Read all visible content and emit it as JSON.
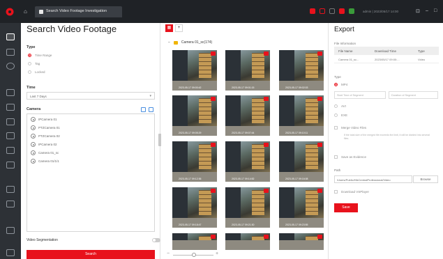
{
  "colors": {
    "accent": "#e8121c",
    "topbar": "#1f2226",
    "nav": "#2d3136"
  },
  "topbar": {
    "tab_label": "Search Video Footage Investigation",
    "user_text": "admin  |  2023/05/17 14:00",
    "icons": [
      "alarm-icon",
      "flag-icon",
      "bell-icon",
      "message-icon",
      "screen-icon"
    ]
  },
  "nav": {
    "icons": [
      "search-icon",
      "monitor-icon",
      "map-icon",
      "event-icon",
      "log-icon",
      "person-icon",
      "vehicle-icon",
      "storage-icon",
      "device-icon",
      "report-icon",
      "file-icon",
      "settings-icon",
      "tool-icon"
    ]
  },
  "search": {
    "title": "Search Video Footage",
    "type_label": "Type",
    "types": [
      "Time Range",
      "Tag",
      "Locked"
    ],
    "time_label": "Time",
    "time_value": "Last 7 Days",
    "camera_label": "Camera",
    "cameras": [
      "IPCamera 01",
      "PTZCamera 01",
      "PTZCamera 02",
      "IPCamera 02",
      "Camera 01_sc",
      "Camera 01/1/1"
    ],
    "segmentation_label": "Video Segmentation",
    "search_button": "Search"
  },
  "grid": {
    "camera_heading": "Camera 01_sc(174)",
    "thumbs": [
      {
        "ts": "2023-05-17 09:00:42"
      },
      {
        "ts": "2023-05-17 09:01:15"
      },
      {
        "ts": "2023-05-17 09:02:03"
      },
      {
        "ts": "2023-05-17 09:05:29"
      },
      {
        "ts": "2023-05-17 09:07:44"
      },
      {
        "ts": "2023-05-17 09:10:11"
      },
      {
        "ts": "2023-05-17 09:12:36"
      },
      {
        "ts": "2023-05-17 09:14:52"
      },
      {
        "ts": "2023-05-17 09:16:08"
      },
      {
        "ts": "2023-05-17 09:18:47"
      },
      {
        "ts": "2023-05-17 09:21:30"
      },
      {
        "ts": "2023-05-17 09:23:55"
      },
      {
        "ts": ""
      },
      {
        "ts": ""
      },
      {
        "ts": ""
      }
    ]
  },
  "export": {
    "title": "Export",
    "file_info_label": "File Information",
    "table_headers": [
      "File Name",
      "Download Time",
      "Type"
    ],
    "table_rows": [
      [
        "Camera 01_sc...",
        "2023/05/17 09:00:...",
        "Video"
      ]
    ],
    "type_label": "Type",
    "formats": [
      "MP4",
      "AVI",
      "EXE"
    ],
    "mp4_start": "Start Time of Segment",
    "mp4_duration": "Duration of Segment",
    "merge_label": "Merge Video Files",
    "merge_note": "If the total size of the merged file exceeds the limit, it will be divided into several files.",
    "evidence_label": "Save as Evidence",
    "path_label": "Path",
    "path_value": "/Users/Public/HikCentralProfessional/Video",
    "browse_label": "Browse",
    "player_label": "Download VSPlayer",
    "save_button": "Save"
  }
}
